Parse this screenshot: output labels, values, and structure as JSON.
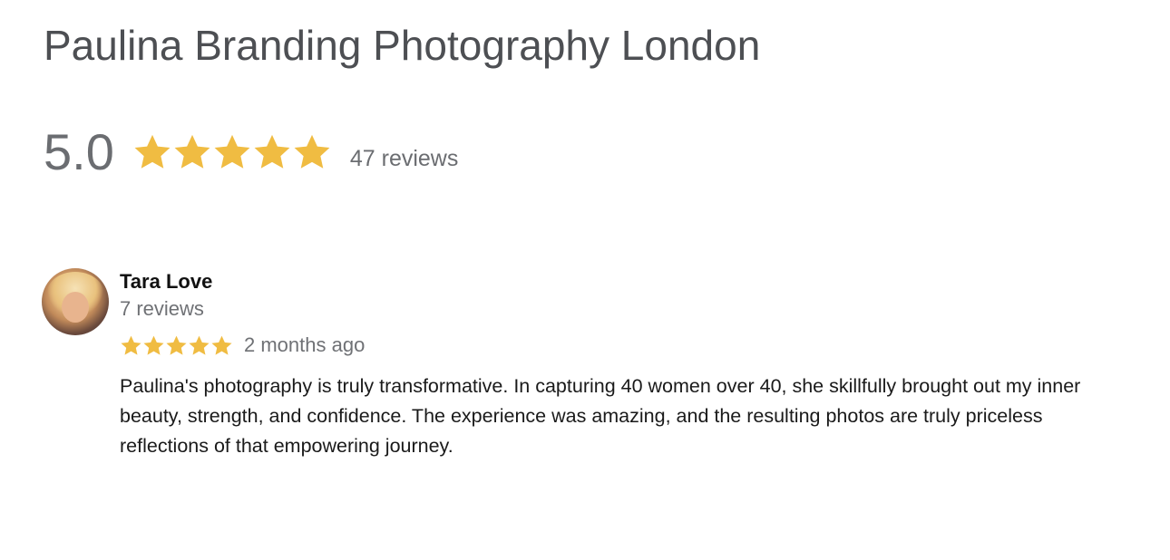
{
  "business": {
    "title": "Paulina Branding Photography London",
    "rating": "5.0",
    "stars": 5,
    "reviews_count": "47 reviews"
  },
  "review": {
    "author": "Tara Love",
    "author_reviews": "7 reviews",
    "stars": 5,
    "date": "2 months ago",
    "text": "Paulina's photography is truly transformative. In capturing 40 women over 40, she skillfully brought out my inner beauty, strength, and confidence. The experience was amazing, and the resulting photos are truly priceless reflections of that empowering journey."
  },
  "colors": {
    "star": "#f0bc42",
    "title": "#4d4f53",
    "muted": "#6f7175",
    "text": "#1a1a1a"
  },
  "icons": {
    "star": "star-icon",
    "avatar": "avatar"
  }
}
